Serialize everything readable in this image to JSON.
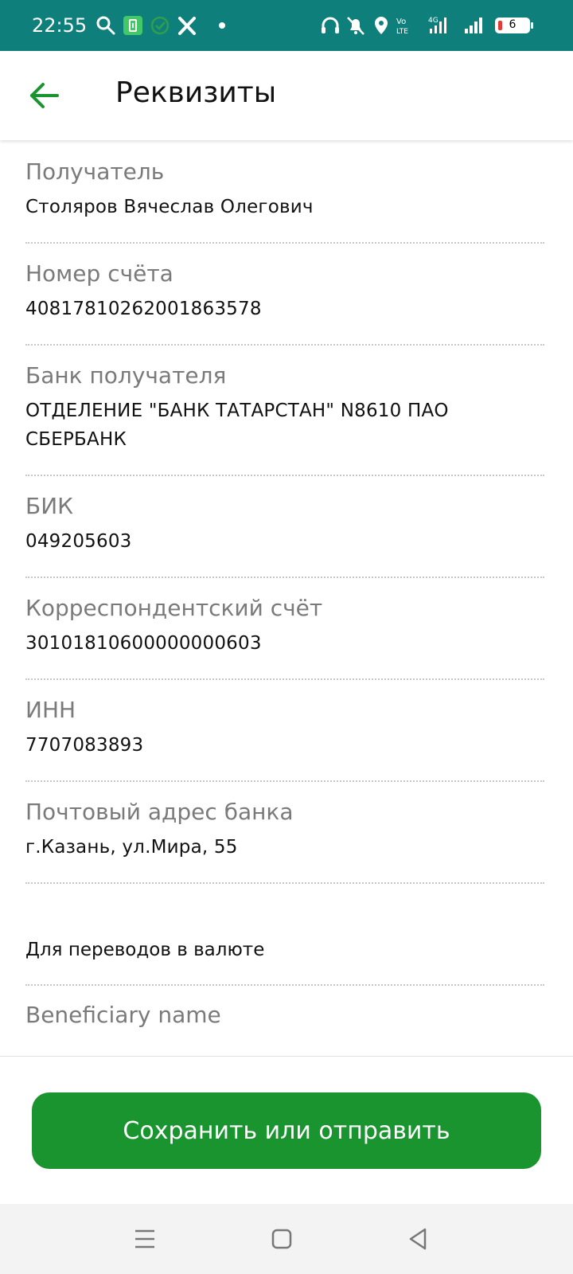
{
  "status_bar": {
    "time": "22:55",
    "battery_level": "6",
    "icons": [
      "search-icon",
      "battery-saver-icon",
      "check-circle-icon",
      "tools-icon",
      "dot-icon",
      "headphones-icon",
      "bell-off-icon",
      "location-icon",
      "volte-icon",
      "signal-4g-icon",
      "signal-icon",
      "battery-icon"
    ]
  },
  "header": {
    "title": "Реквизиты",
    "back_icon": "arrow-left-icon"
  },
  "details": [
    {
      "label": "Получатель",
      "value": "Столяров Вячеслав Олегович"
    },
    {
      "label": "Номер счёта",
      "value": "40817810262001863578"
    },
    {
      "label": "Банк получателя",
      "value": "ОТДЕЛЕНИЕ \"БАНК ТАТАРСТАН\" N8610 ПАО СБЕРБАНК"
    },
    {
      "label": "БИК",
      "value": "049205603"
    },
    {
      "label": "Корреспондентский счёт",
      "value": "30101810600000000603"
    },
    {
      "label": "ИНН",
      "value": "7707083893"
    },
    {
      "label": "Почтовый адрес банка",
      "value": "г.Казань, ул.Мира, 55"
    }
  ],
  "currency_section": {
    "title": "Для переводов в валюте",
    "first_label": "Beneficiary name"
  },
  "actions": {
    "save_label": "Сохранить или отправить"
  },
  "colors": {
    "status_bar": "#0f7f7c",
    "accent": "#1a942f",
    "label": "#7a7a7a"
  }
}
